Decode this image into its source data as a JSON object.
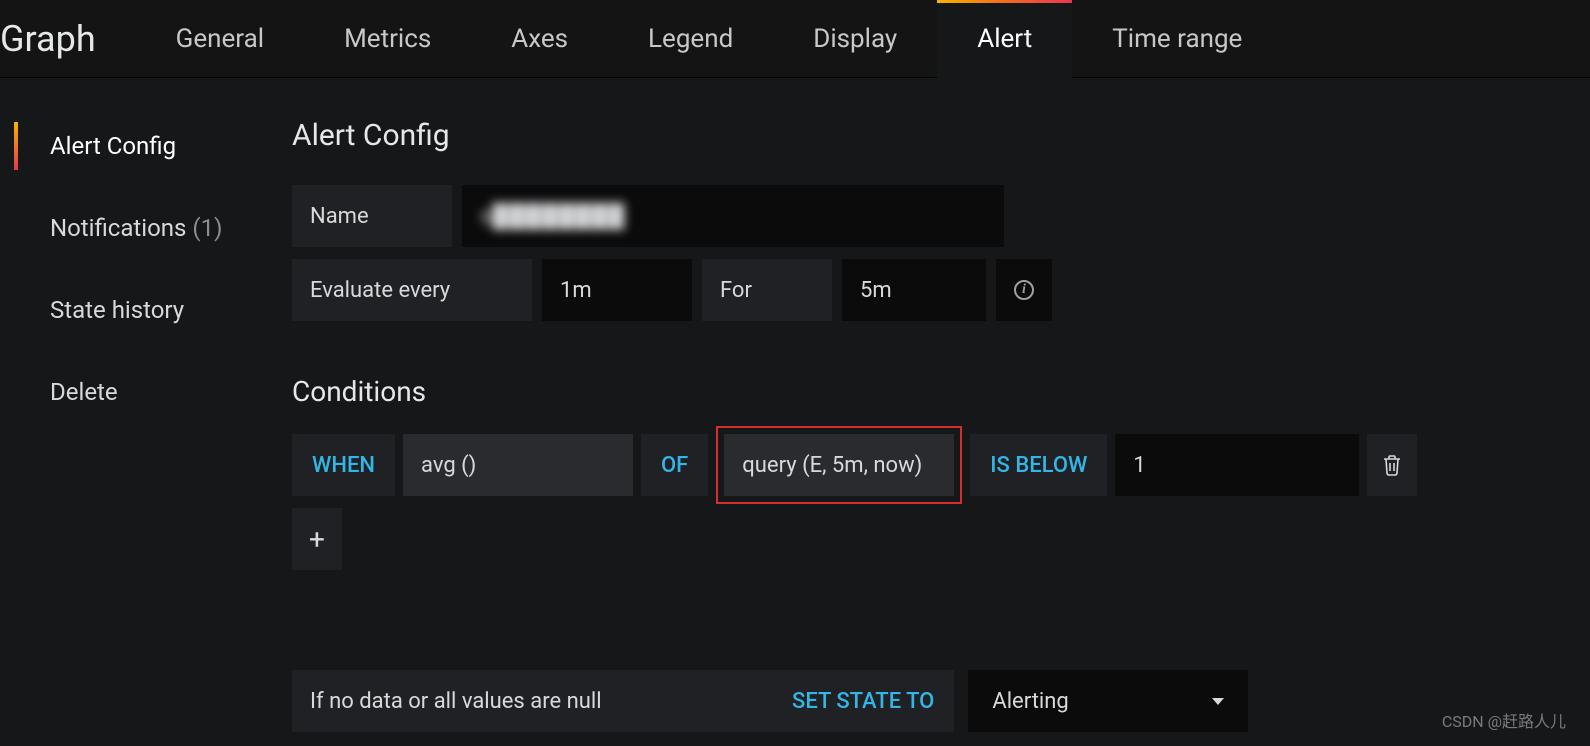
{
  "header": {
    "panel_type": "Graph",
    "tabs": [
      "General",
      "Metrics",
      "Axes",
      "Legend",
      "Display",
      "Alert",
      "Time range"
    ],
    "active_tab": "Alert"
  },
  "sidebar": {
    "items": [
      {
        "label": "Alert Config",
        "active": true
      },
      {
        "label": "Notifications",
        "count": "(1)"
      },
      {
        "label": "State history"
      },
      {
        "label": "Delete"
      }
    ]
  },
  "alert_config": {
    "title": "Alert Config",
    "name_label": "Name",
    "name_value": "s████████",
    "evaluate_label": "Evaluate every",
    "evaluate_value": "1m",
    "for_label": "For",
    "for_value": "5m"
  },
  "conditions": {
    "title": "Conditions",
    "row": {
      "when": "WHEN",
      "aggregator": "avg ()",
      "of": "OF",
      "query": "query (E, 5m, now)",
      "comparator": "IS BELOW",
      "threshold": "1"
    }
  },
  "no_data": {
    "label": "If no data or all values are null",
    "keyword": "SET STATE TO",
    "value": "Alerting"
  },
  "watermark": "CSDN @赶路人儿"
}
